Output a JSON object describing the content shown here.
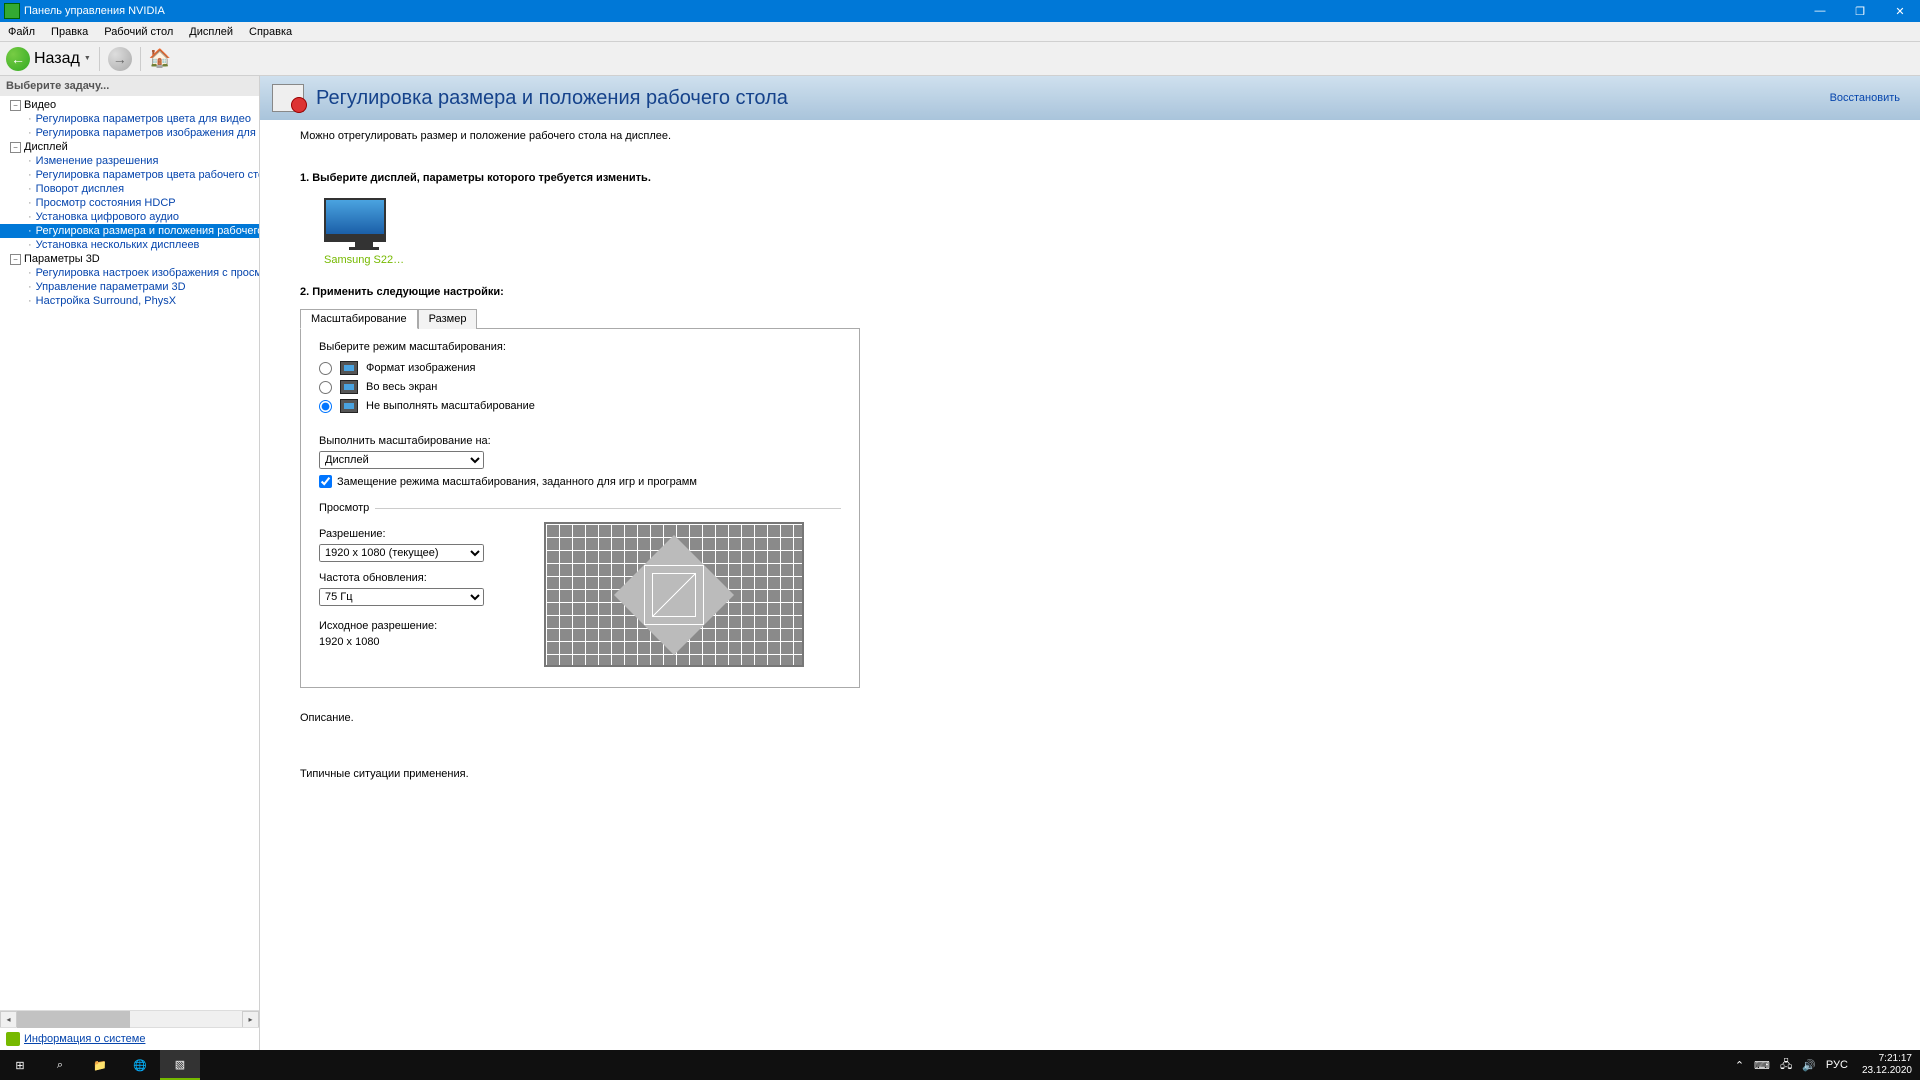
{
  "window": {
    "title": "Панель управления NVIDIA"
  },
  "menu": {
    "file": "Файл",
    "edit": "Правка",
    "desktop": "Рабочий стол",
    "display": "Дисплей",
    "help": "Справка"
  },
  "nav": {
    "back": "Назад"
  },
  "sidebar": {
    "header": "Выберите задачу...",
    "cat_video": "Видео",
    "video": {
      "color": "Регулировка параметров цвета для видео",
      "image": "Регулировка параметров изображения для видео"
    },
    "cat_display": "Дисплей",
    "display": {
      "resolution": "Изменение разрешения",
      "deskcolor": "Регулировка параметров цвета рабочего стола",
      "rotate": "Поворот дисплея",
      "hdcp": "Просмотр состояния HDCP",
      "digaudio": "Установка цифрового аудио",
      "sizepos": "Регулировка размера и положения рабочего стола",
      "multi": "Установка нескольких дисплеев"
    },
    "cat_3d": "Параметры 3D",
    "d3d": {
      "imgpref": "Регулировка настроек изображения с просмотром",
      "manage": "Управление параметрами 3D",
      "surround": "Настройка Surround, PhysX"
    },
    "sysinfo": "Информация о системе"
  },
  "page": {
    "title": "Регулировка размера и положения рабочего стола",
    "restore": "Восстановить",
    "intro": "Можно отрегулировать размер и положение рабочего стола на дисплее.",
    "step1": "1. Выберите дисплей, параметры которого требуется изменить.",
    "monitor_label": "Samsung S22…",
    "step2": "2. Применить следующие настройки:",
    "tab_scaling": "Масштабирование",
    "tab_size": "Размер",
    "choose_mode": "Выберите режим масштабирования:",
    "opt_aspect": "Формат изображения",
    "opt_full": "Во весь экран",
    "opt_none": "Не выполнять масштабирование",
    "scale_on_label": "Выполнить масштабирование на:",
    "scale_on_value": "Дисплей",
    "override": "Замещение режима масштабирования, заданного для игр и программ",
    "preview_legend": "Просмотр",
    "res_label": "Разрешение:",
    "res_value": "1920 x 1080 (текущее)",
    "refresh_label": "Частота обновления:",
    "refresh_value": "75 Гц",
    "native_label": "Исходное разрешение:",
    "native_value": "1920 x 1080",
    "desc_hdr": "Описание.",
    "scenarios_hdr": "Типичные ситуации применения."
  },
  "taskbar": {
    "lang": "РУС",
    "time": "7:21:17",
    "date": "23.12.2020"
  }
}
